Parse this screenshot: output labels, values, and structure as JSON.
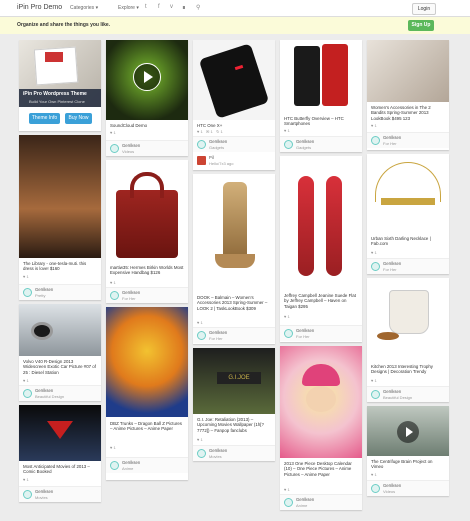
{
  "header": {
    "brand": "iPin Pro Demo",
    "nav": [
      "Categories ▾",
      "Explore ▾"
    ],
    "icons": [
      "twitter-icon",
      "facebook-icon",
      "vimeo-icon",
      "rss-icon",
      "search-icon"
    ],
    "login": "Login"
  },
  "banner": {
    "tagline": "Organize and share the things you like.",
    "signup": "Sign Up"
  },
  "promo": {
    "title": "iPin Pro Wordpress Theme",
    "subtitle": "Build Your Own Pinterest Clone",
    "btn_info": "Theme Info",
    "btn_buy": "Buy Now",
    "colors": {
      "info": "#3aa0d8",
      "buy": "#3aa0d8"
    }
  },
  "pins": [
    {
      "caption": "The Library - one-tesla-muti. this dress is love! $160",
      "stats": "♥ 1",
      "user": "Gerriksen",
      "board": "Pretty",
      "colors": [
        "#2a1b12",
        "#a66a3d"
      ]
    },
    {
      "caption": "Volvo V40 R-Design 2013 Widescreen Exotic Car Picture #07 of 25 : Diesel Station",
      "stats": "♥ 1",
      "user": "Gerriksen",
      "board": "Beautiful Design",
      "colors": [
        "#222",
        "#aab0b6"
      ]
    },
    {
      "caption": "Most Anticipated Movies of 2013 – Comic Booked",
      "stats": "♥ 1",
      "user": "Gerriksen",
      "board": "Movies",
      "colors": [
        "#0a0a0a",
        "#2a3a5a"
      ]
    },
    {
      "caption": "SoundCloud Demo",
      "stats": "♥ 1",
      "user": "Gerriksen",
      "board": "Videos",
      "colors": [
        "#1d2a10",
        "#7bbd2e"
      ]
    },
    {
      "caption": "martiw35: Hermes Birkin Worlds Most Expensive Handbag $126",
      "stats": "♥ 1",
      "user": "Gerriksen",
      "board": "For Her",
      "colors": [
        "#ffffff",
        "#8a1e1a"
      ]
    },
    {
      "caption": "DBZ Trunks – Dragon Ball Z Pictures – Anime Pictures – Anime Paper",
      "stats": "♥ 1",
      "user": "Gerriksen",
      "board": "Anime",
      "colors": [
        "#1f3c8a",
        "#f2c230"
      ]
    },
    {
      "caption": "HTC One X+",
      "stats": "♥ 1   ✉ 1   ↻ 1",
      "user": "Gerriksen",
      "board": "Gadgets",
      "colors": [
        "#f4f4f4",
        "#111111"
      ]
    },
    {
      "caption": "DOOK – Balmain – Women's Accessories 2013 Spring-Summer – LOOK 2 | TaskLookBook $309",
      "stats": "♥ 1",
      "user": "Gerriksen",
      "board": "For Her",
      "colors": [
        "#ffffff",
        "#b48a55"
      ]
    },
    {
      "caption": "G.I. Joe: Retaliation (2013) – Upcoming Movies Wallpaper (1h[?7772]) – Fanpop fanclubs",
      "stats": "♥ 1",
      "user": "Gerriksen",
      "board": "Movies",
      "colors": [
        "#1e1e1e",
        "#5a6a3a"
      ]
    },
    {
      "caption": "HTC Butterfly Overview – HTC Smartphones",
      "stats": "♥ 1",
      "user": "Gerriksen",
      "board": "Gadgets",
      "colors": [
        "#ffffff",
        "#1a1a1a"
      ]
    },
    {
      "caption": "Jeffrey Campbell Jeanine Suede Flat by Jeffrey Campbell – Haven on Taigan $295",
      "stats": "♥ 1",
      "user": "Gerriksen",
      "board": "For Her",
      "colors": [
        "#ffffff",
        "#c0292a"
      ]
    },
    {
      "caption": "2013 One Piece Desktop Calendar (10) – One Piece Pictures – Anime Pictures – Anime Paper",
      "stats": "♥ 1",
      "user": "Gerriksen",
      "board": "Anime",
      "colors": [
        "#f4c3cf",
        "#e55a8a"
      ]
    },
    {
      "caption": "Women's Accessories in The 2 Bandits Spring-Summer 2013 LookBook $495 123",
      "stats": "♥ 1",
      "user": "Gerriksen",
      "board": "For Her",
      "colors": [
        "#d9d1c8",
        "#8c7e70"
      ]
    },
    {
      "caption": "Urban Sixth Darling Necklace | Fab.com",
      "stats": "♥ 1",
      "user": "Gerriksen",
      "board": "For Her",
      "colors": [
        "#ffffff",
        "#c9a540"
      ]
    },
    {
      "caption": "Kitchen 2013 Interesting Trophy Designs | Decoration Trendy",
      "stats": "♥ 1",
      "user": "Gerriksen",
      "board": "Beautiful Design",
      "colors": [
        "#ffffff",
        "#d2c8b6"
      ]
    },
    {
      "caption": "The Centrifuge Brain Project on Vimeo",
      "stats": "♥ 1",
      "user": "Gerriksen",
      "board": "Videos",
      "colors": [
        "#6e7e72",
        "#bfc8c0"
      ]
    }
  ],
  "comment": {
    "user": "Pil",
    "text": "Hello/7x3 ago"
  }
}
